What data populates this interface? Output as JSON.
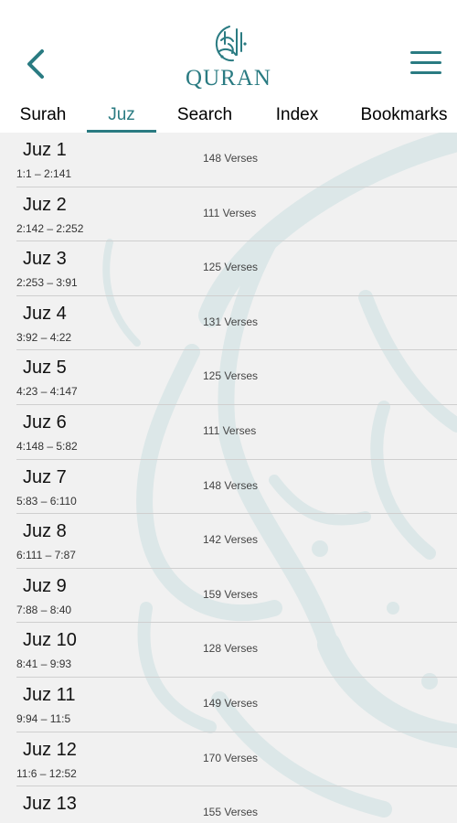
{
  "header": {
    "logo_text": "QURAN",
    "logo_arabic": "القرآن الكريم",
    "back_icon": "chevron-left-icon",
    "menu_icon": "hamburger-menu-icon",
    "accent_color": "#2a7b82"
  },
  "tabs": [
    {
      "label": "Surah",
      "active": false
    },
    {
      "label": "Juz",
      "active": true
    },
    {
      "label": "Search",
      "active": false
    },
    {
      "label": "Index",
      "active": false
    },
    {
      "label": "Bookmarks",
      "active": false
    }
  ],
  "juz_list": [
    {
      "title": "Juz 1",
      "range": "1:1 – 2:141",
      "verses": "148 Verses"
    },
    {
      "title": "Juz 2",
      "range": "2:142 – 2:252",
      "verses": "111 Verses"
    },
    {
      "title": "Juz 3",
      "range": "2:253 – 3:91",
      "verses": "125 Verses"
    },
    {
      "title": "Juz 4",
      "range": "3:92 – 4:22",
      "verses": "131 Verses"
    },
    {
      "title": "Juz 5",
      "range": "4:23 – 4:147",
      "verses": "125 Verses"
    },
    {
      "title": "Juz 6",
      "range": "4:148 – 5:82",
      "verses": "111 Verses"
    },
    {
      "title": "Juz 7",
      "range": "5:83 – 6:110",
      "verses": "148 Verses"
    },
    {
      "title": "Juz 8",
      "range": "6:111 – 7:87",
      "verses": "142 Verses"
    },
    {
      "title": "Juz 9",
      "range": "7:88 – 8:40",
      "verses": "159 Verses"
    },
    {
      "title": "Juz 10",
      "range": "8:41 – 9:93",
      "verses": "128 Verses"
    },
    {
      "title": "Juz 11",
      "range": "9:94 – 11:5",
      "verses": "149 Verses"
    },
    {
      "title": "Juz 12",
      "range": "11:6 – 12:52",
      "verses": "170 Verses"
    },
    {
      "title": "Juz 13",
      "range": "",
      "verses": "155 Verses"
    }
  ]
}
